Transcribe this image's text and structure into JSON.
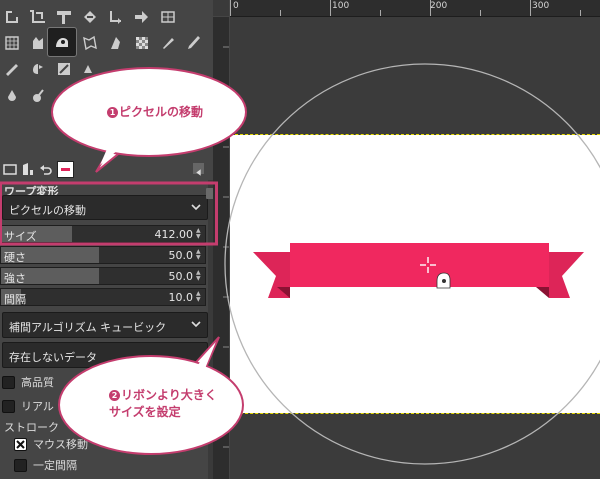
{
  "toolbox": {
    "tools": [
      {
        "name": "free-select-icon"
      },
      {
        "name": "crop-icon"
      },
      {
        "name": "unified-transform-icon"
      },
      {
        "name": "warp-transform-icon"
      },
      {
        "name": "flip-icon"
      },
      {
        "name": "align-icon"
      },
      {
        "name": "cage-transform-icon"
      },
      {
        "name": "perspective-clone-icon"
      },
      {
        "name": "move-tool-icon"
      },
      {
        "name": "handle-transform-icon"
      },
      {
        "name": "bucket-fill-icon"
      },
      {
        "name": "blend-icon"
      },
      {
        "name": "pencil-icon"
      },
      {
        "name": "smudge-icon"
      },
      {
        "name": "heal-icon"
      },
      {
        "name": "dodge-burn-icon"
      },
      {
        "name": "ink-icon"
      },
      {
        "name": "path-icon"
      },
      {
        "name": "text-icon"
      },
      {
        "name": "color-picker-icon"
      },
      {
        "name": "zoom-icon"
      }
    ]
  },
  "tool_options": {
    "title": "ワープ変形",
    "behavior_label": "ピクセルの移動",
    "size": {
      "label": "サイズ",
      "value": "412.00",
      "fill": 0.35
    },
    "hardness": {
      "label": "硬さ",
      "value": "50.0",
      "fill": 0.5
    },
    "strength": {
      "label": "強さ",
      "value": "50.0",
      "fill": 0.5
    },
    "spacing": {
      "label": "間隔",
      "value": "10.0",
      "fill": 0.1
    },
    "interpolation_label": "補間アルゴリズム  キュービック",
    "abyss_label": "存在しないデータ",
    "high_quality_label": "高品質",
    "realtime_label": "リアル",
    "stroke_label": "ストローク",
    "during_motion_label": "マウス移動",
    "periodically_label": "一定間隔"
  },
  "ruler": {
    "ticks": [
      "0",
      "100",
      "200",
      "300"
    ]
  },
  "canvas": {
    "ribbon_color": "#f0285f",
    "ribbon_dark_color": "#c51c4a",
    "selection_color": "#e4d800"
  },
  "callouts": {
    "first": {
      "number": "1",
      "text": "ピクセルの移動"
    },
    "second": {
      "number": "2",
      "line1": "リボンより大きく",
      "line2": "サイズを設定"
    }
  },
  "colors": {
    "accent": "#c43d6e",
    "panel_bg": "#454545",
    "canvas_bg": "#3b3b3b"
  }
}
